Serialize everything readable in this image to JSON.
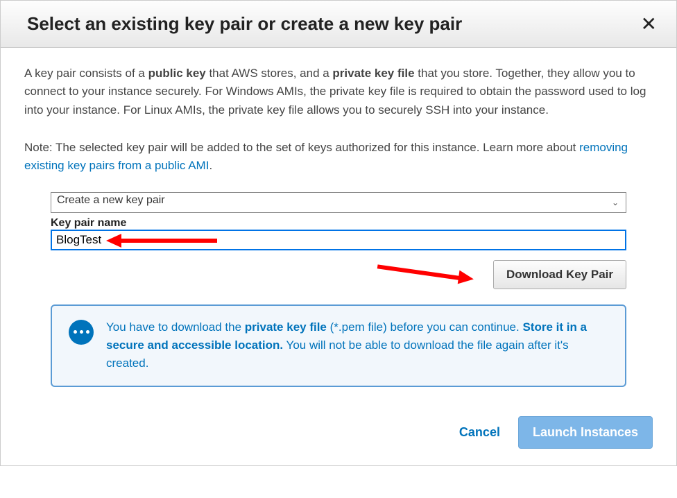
{
  "header": {
    "title": "Select an existing key pair or create a new key pair"
  },
  "desc": {
    "p1_a": "A key pair consists of a ",
    "p1_b": "public key",
    "p1_c": " that AWS stores, and a ",
    "p1_d": "private key file",
    "p1_e": " that you store. Together, they allow you to connect to your instance securely. For Windows AMIs, the private key file is required to obtain the password used to log into your instance. For Linux AMIs, the private key file allows you to securely SSH into your instance.",
    "p2_a": "Note: The selected key pair will be added to the set of keys authorized for this instance. Learn more about ",
    "p2_link": "removing existing key pairs from a public AMI",
    "p2_b": "."
  },
  "form": {
    "select_value": "Create a new key pair",
    "keypair_label": "Key pair name",
    "keypair_value": "BlogTest",
    "download_button": "Download Key Pair"
  },
  "info": {
    "t1": "You have to download the ",
    "t2": "private key file",
    "t3": " (*.pem file) before you can continue. ",
    "t4": "Store it in a secure and accessible location.",
    "t5": " You will not be able to download the file again after it's created."
  },
  "footer": {
    "cancel": "Cancel",
    "launch": "Launch Instances"
  }
}
